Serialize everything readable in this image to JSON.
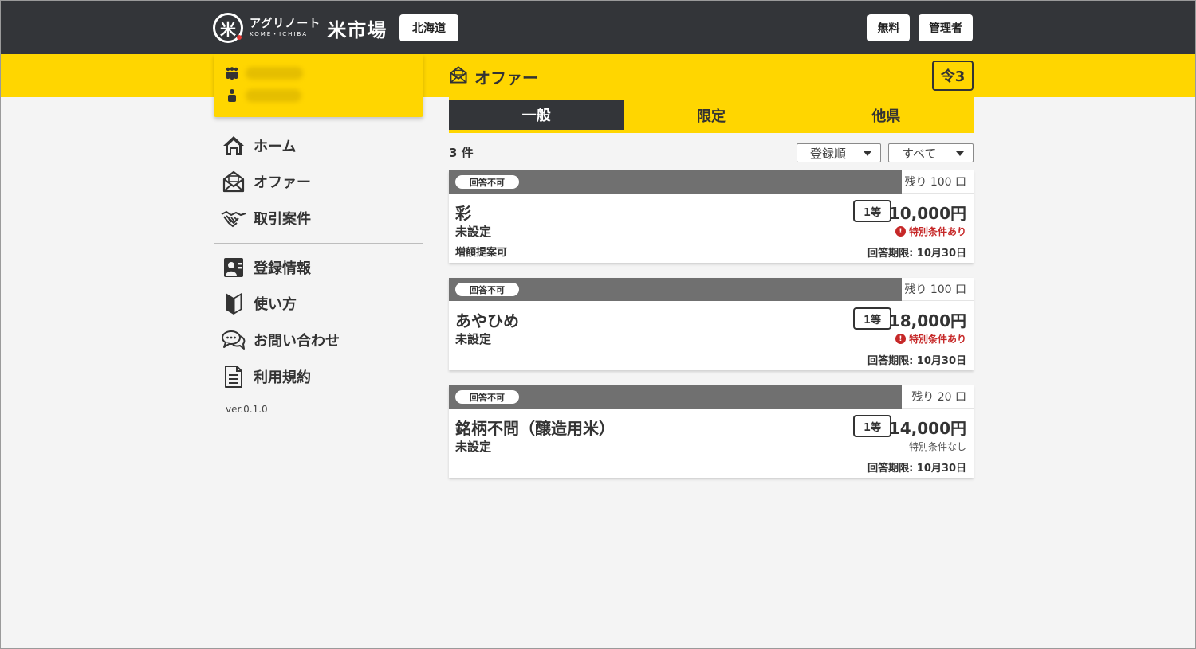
{
  "header": {
    "logo_mark": "米",
    "logo_kana": "アグリノート",
    "logo_roman": "KOME・ICHIBA",
    "logo_main": "米市場",
    "region": "北海道",
    "free_label": "無料",
    "admin_label": "管理者"
  },
  "user": {
    "org_name": "",
    "person_name": ""
  },
  "sidebar": {
    "items": [
      {
        "label": "ホーム",
        "icon": "home-icon"
      },
      {
        "label": "オファー",
        "icon": "envelope-open-icon"
      },
      {
        "label": "取引案件",
        "icon": "handshake-icon"
      },
      {
        "label": "登録情報",
        "icon": "profile-card-icon"
      },
      {
        "label": "使い方",
        "icon": "beginner-mark-icon"
      },
      {
        "label": "お問い合わせ",
        "icon": "chat-bubbles-icon"
      },
      {
        "label": "利用規約",
        "icon": "document-icon"
      }
    ],
    "version": "ver.0.1.0"
  },
  "main": {
    "title": "オファー",
    "year_badge": "令3",
    "tabs": [
      {
        "label": "一般",
        "active": true
      },
      {
        "label": "限定",
        "active": false
      },
      {
        "label": "他県",
        "active": false
      }
    ],
    "count": "3 件",
    "sort_select": "登録順",
    "filter_select": "すべて"
  },
  "offers": [
    {
      "status": "回答不可",
      "remaining": "残り 100 口",
      "variety": "彩",
      "sub1": "未設定",
      "sub2": "増額提案可",
      "grade": "1等",
      "price": "10,000円",
      "condition": "特別条件あり",
      "has_special": true,
      "deadline": "回答期限: 10月30日"
    },
    {
      "status": "回答不可",
      "remaining": "残り 100 口",
      "variety": "あやひめ",
      "sub1": "未設定",
      "sub2": "",
      "grade": "1等",
      "price": "18,000円",
      "condition": "特別条件あり",
      "has_special": true,
      "deadline": "回答期限: 10月30日"
    },
    {
      "status": "回答不可",
      "remaining": "残り 20 口",
      "variety": "銘柄不問（醸造用米）",
      "sub1": "未設定",
      "sub2": "",
      "grade": "1等",
      "price": "14,000円",
      "condition": "特別条件なし",
      "has_special": false,
      "deadline": "回答期限: 10月30日"
    }
  ],
  "colors": {
    "header_bg": "#333539",
    "accent_yellow": "#ffd600",
    "card_head_gray": "#707070",
    "special_red": "#c62828"
  }
}
